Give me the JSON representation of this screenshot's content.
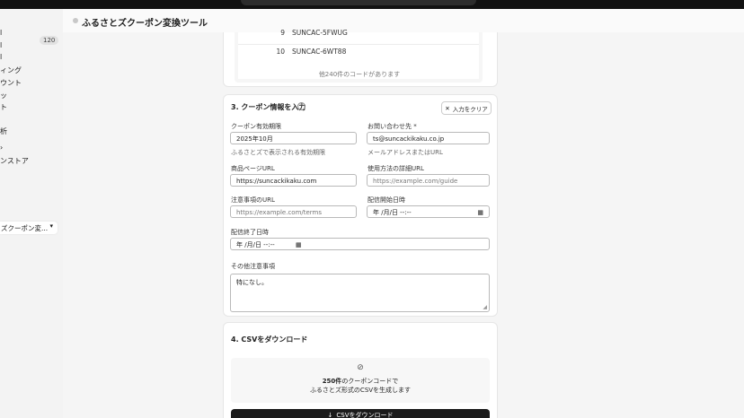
{
  "app": {
    "title": "ふるさとズクーポン変換ツール"
  },
  "sidebar": {
    "badge": "120",
    "items": [
      "l",
      "l",
      "l",
      "ィング",
      "ウント",
      "ッ",
      "ト",
      "析",
      "›",
      "ンストア"
    ],
    "selected": {
      "label": "ズクーポン変...",
      "caret": "▾"
    }
  },
  "code_list": {
    "rows": [
      {
        "num": "9",
        "code": "SUNCAC-5FWUG"
      },
      {
        "num": "10",
        "code": "SUNCAC-6WT88"
      }
    ],
    "more_text": "他240件のコードがあります"
  },
  "coupon_info": {
    "title": "3. クーポン情報を入力",
    "help_icon": "?",
    "clear_label": "入力をクリア",
    "fields": {
      "expiry": {
        "label": "クーポン有効期限",
        "value": "2025年10月",
        "hint": "ふるさとズで表示される有効期限"
      },
      "contact": {
        "label": "お問い合わせ先 *",
        "value": "ts@suncackikaku.co.jp",
        "hint": "メールアドレスまたはURL"
      },
      "product_url": {
        "label": "商品ページURL",
        "value": "https://suncackikaku.com"
      },
      "usage_url": {
        "label": "使用方法の詳細URL",
        "placeholder": "https://example.com/guide"
      },
      "notes_url": {
        "label": "注意事項のURL",
        "placeholder": "https://example.com/terms"
      },
      "start_date": {
        "label": "配信開始日時",
        "placeholder": "年 /月/日 --:--"
      },
      "end_date": {
        "label": "配信終了日時",
        "placeholder": "年 /月/日 --:--"
      },
      "other_notes": {
        "label": "その他注意事項",
        "value": "特になし。"
      }
    }
  },
  "download": {
    "title": "4. CSVをダウンロード",
    "count": "250件",
    "line1_suffix": "のクーポンコードで",
    "line2": "ふるさとズ形式のCSVを生成します",
    "button_label": "CSVをダウンロード"
  }
}
